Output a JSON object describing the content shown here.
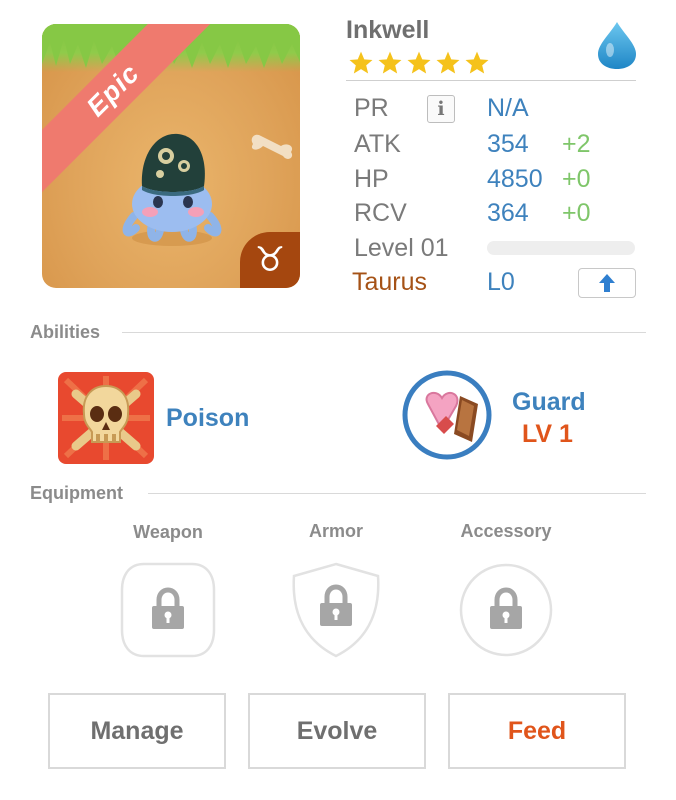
{
  "monster": {
    "name": "Inkwell",
    "rarity": "Epic",
    "star_count": 5,
    "element_icon": "water-drop-icon",
    "zodiac_symbol": "♉"
  },
  "stats": {
    "pr": {
      "label": "PR",
      "value": "N/A"
    },
    "pr_info": "i",
    "atk": {
      "label": "ATK",
      "value": "354",
      "bonus": "+2"
    },
    "hp": {
      "label": "HP",
      "value": "4850",
      "bonus": "+0"
    },
    "rcv": {
      "label": "RCV",
      "value": "364",
      "bonus": "+0"
    },
    "level": {
      "label": "Level 01",
      "progress": 0
    },
    "zodiac": {
      "label": "Taurus",
      "level": "L0"
    }
  },
  "abilities": {
    "title": "Abilities",
    "items": [
      {
        "name": "Poison",
        "icon": "skull-crossbones-icon"
      },
      {
        "name": "Guard",
        "level": "LV 1",
        "icon": "heart-shield-icon"
      }
    ]
  },
  "equipment": {
    "title": "Equipment",
    "slots": [
      {
        "label": "Weapon",
        "icon": "lock-icon"
      },
      {
        "label": "Armor",
        "icon": "lock-icon"
      },
      {
        "label": "Accessory",
        "icon": "lock-icon"
      }
    ]
  },
  "actions": {
    "manage": "Manage",
    "evolve": "Evolve",
    "feed": "Feed"
  },
  "colors": {
    "stat_value": "#3e82bd",
    "stat_bonus": "#7fc66a",
    "zodiac": "#a55216",
    "feed": "#e0551b",
    "epic_ribbon": "#ef7a6e"
  }
}
